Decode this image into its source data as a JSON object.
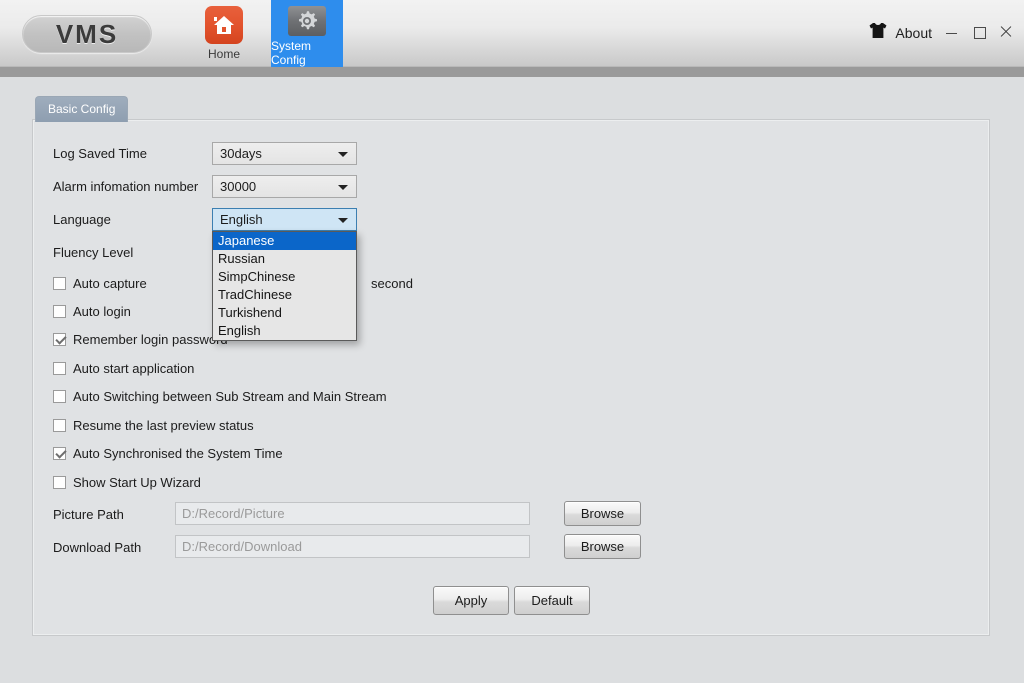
{
  "titlebar": {
    "logo": "VMS",
    "nav": [
      {
        "id": "home",
        "label": "Home",
        "icon": "home-icon"
      },
      {
        "id": "system-config",
        "label": "System Config",
        "icon": "gear-icon",
        "active": true
      }
    ],
    "about_label": "About",
    "about_icon": "about-shirt-icon",
    "window_controls": [
      "minimize",
      "maximize",
      "close"
    ]
  },
  "tab": {
    "label": "Basic Config"
  },
  "form": {
    "log_saved_time": {
      "label": "Log Saved Time",
      "value": "30days"
    },
    "alarm_info_number": {
      "label": "Alarm infomation number",
      "value": "30000"
    },
    "language": {
      "label": "Language",
      "value": "English"
    },
    "fluency_level": {
      "label": "Fluency Level"
    },
    "second_label": "second",
    "language_options": [
      "Japanese",
      "Russian",
      "SimpChinese",
      "TradChinese",
      "Turkishend",
      "English"
    ],
    "language_highlighted": "Japanese",
    "checkboxes": [
      {
        "label": "Auto capture",
        "checked": false
      },
      {
        "label": "Auto login",
        "checked": false
      },
      {
        "label": "Remember login password",
        "checked": true
      },
      {
        "label": "Auto start application",
        "checked": false
      },
      {
        "label": "Auto Switching between Sub Stream and Main Stream",
        "checked": false
      },
      {
        "label": "Resume the last preview status",
        "checked": false
      },
      {
        "label": "Auto Synchronised the System Time",
        "checked": true
      },
      {
        "label": "Show Start Up Wizard",
        "checked": false
      }
    ],
    "picture_path": {
      "label": "Picture Path",
      "value": "D:/Record/Picture",
      "button": "Browse"
    },
    "download_path": {
      "label": "Download Path",
      "value": "D:/Record/Download",
      "button": "Browse"
    },
    "apply_button": "Apply",
    "default_button": "Default"
  },
  "colors": {
    "accent_blue": "#2e8ded",
    "highlight_blue": "#0b66c9",
    "home_orange": "#e2522c",
    "panel_bg": "#e0e2e4",
    "window_bg": "#dcdee0"
  }
}
